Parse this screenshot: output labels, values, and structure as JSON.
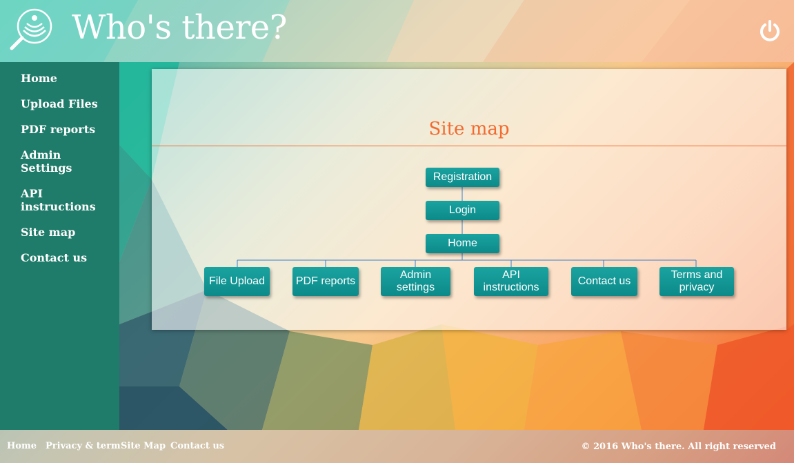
{
  "header": {
    "brand": "Who's there?",
    "logo_icon": "magnifier-signal-icon",
    "power_icon": "power-icon"
  },
  "sidebar": {
    "items": [
      {
        "label": "Home"
      },
      {
        "label": "Upload Files"
      },
      {
        "label": "PDF reports"
      },
      {
        "label": "Admin Settings"
      },
      {
        "label": "API instructions"
      },
      {
        "label": "Site map"
      },
      {
        "label": "Contact us"
      }
    ]
  },
  "main": {
    "title": "Site map",
    "tree": {
      "registration": "Registration",
      "login": "Login",
      "home": "Home",
      "children": [
        {
          "label": "File Upload"
        },
        {
          "label": "PDF reports"
        },
        {
          "label": "Admin settings"
        },
        {
          "label": "API instructions"
        },
        {
          "label": "Contact us"
        },
        {
          "label": "Terms and privacy"
        }
      ]
    }
  },
  "footer": {
    "links": [
      {
        "label": "Home"
      },
      {
        "label": "Privacy & term"
      },
      {
        "label": "Site Map"
      },
      {
        "label": "Contact us"
      }
    ],
    "copyright": "© 2016 Who's there. All right reserved"
  },
  "colors": {
    "sidebar": "#207c6a",
    "accent": "#f26a2f",
    "node": "#0c8a8a"
  }
}
